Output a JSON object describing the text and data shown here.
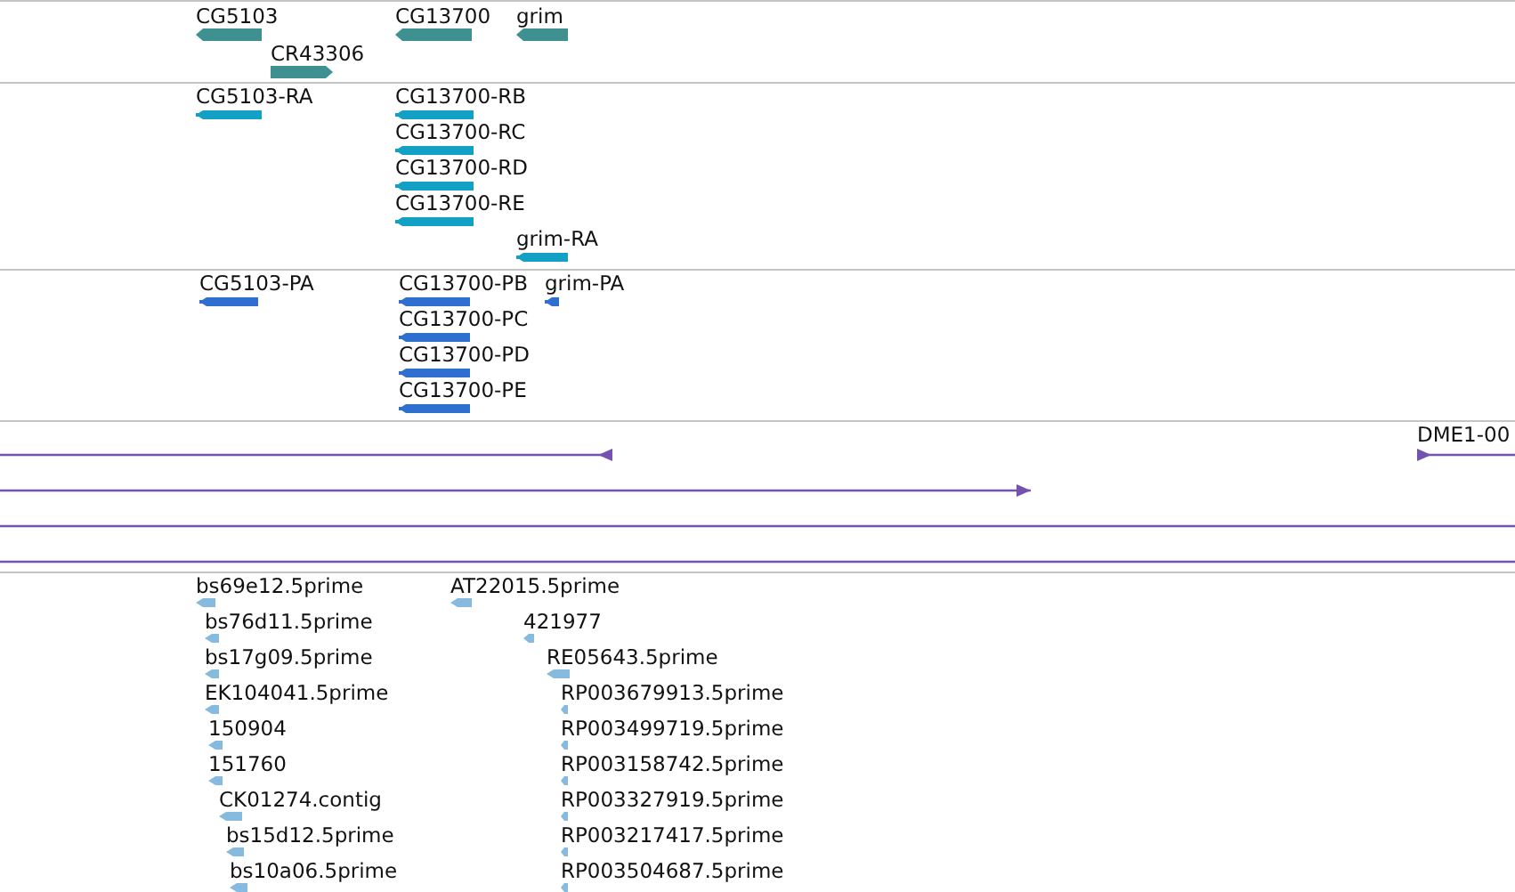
{
  "tracks": [
    {
      "kind": "gene",
      "color": "#3f9191",
      "features": [
        {
          "label": "CG5103",
          "reverse": true
        },
        {
          "label": "CR43306",
          "reverse": false
        },
        {
          "label": "CG13700",
          "reverse": true
        },
        {
          "label": "grim",
          "reverse": true
        }
      ]
    },
    {
      "kind": "transcript",
      "color": "#12a0c4",
      "features": [
        {
          "label": "CG5103-RA",
          "reverse": true
        },
        {
          "label": "CG13700-RB",
          "reverse": true
        },
        {
          "label": "CG13700-RC",
          "reverse": true
        },
        {
          "label": "CG13700-RD",
          "reverse": true
        },
        {
          "label": "CG13700-RE",
          "reverse": true
        },
        {
          "label": "grim-RA",
          "reverse": true
        }
      ]
    },
    {
      "kind": "transcript",
      "color": "#2f6fcf",
      "features": [
        {
          "label": "CG5103-PA",
          "reverse": true
        },
        {
          "label": "CG13700-PB",
          "reverse": true
        },
        {
          "label": "grim-PA",
          "reverse": true
        },
        {
          "label": "CG13700-PC",
          "reverse": true
        },
        {
          "label": "CG13700-PD",
          "reverse": true
        },
        {
          "label": "CG13700-PE",
          "reverse": true
        }
      ]
    },
    {
      "kind": "line",
      "color": "#7352b0",
      "features": [
        {
          "reverse": true,
          "arrow": true
        },
        {
          "reverse": false,
          "arrow": true
        },
        {
          "arrow": false
        },
        {
          "arrow": false
        },
        {
          "label": "DME1-00",
          "reverse": false,
          "arrow": true
        }
      ]
    },
    {
      "kind": "match",
      "color": "#86badf",
      "features": [
        {
          "label": "bs69e12.5prime",
          "reverse": true
        },
        {
          "label": "bs76d11.5prime",
          "reverse": true
        },
        {
          "label": "bs17g09.5prime",
          "reverse": true
        },
        {
          "label": "EK104041.5prime",
          "reverse": true
        },
        {
          "label": "150904",
          "reverse": true
        },
        {
          "label": "151760",
          "reverse": true
        },
        {
          "label": "CK01274.contig",
          "reverse": true
        },
        {
          "label": "bs15d12.5prime",
          "reverse": true
        },
        {
          "label": "bs10a06.5prime",
          "reverse": true
        },
        {
          "label": "AT22015.5prime",
          "reverse": true
        },
        {
          "label": "421977",
          "reverse": true
        },
        {
          "label": "RE05643.5prime",
          "reverse": true
        },
        {
          "label": "RP003679913.5prime",
          "reverse": true
        },
        {
          "label": "RP003499719.5prime",
          "reverse": true
        },
        {
          "label": "RP003158742.5prime",
          "reverse": true
        },
        {
          "label": "RP003327919.5prime",
          "reverse": true
        },
        {
          "label": "RP003217417.5prime",
          "reverse": true
        },
        {
          "label": "RP003504687.5prime",
          "reverse": true
        }
      ]
    }
  ]
}
